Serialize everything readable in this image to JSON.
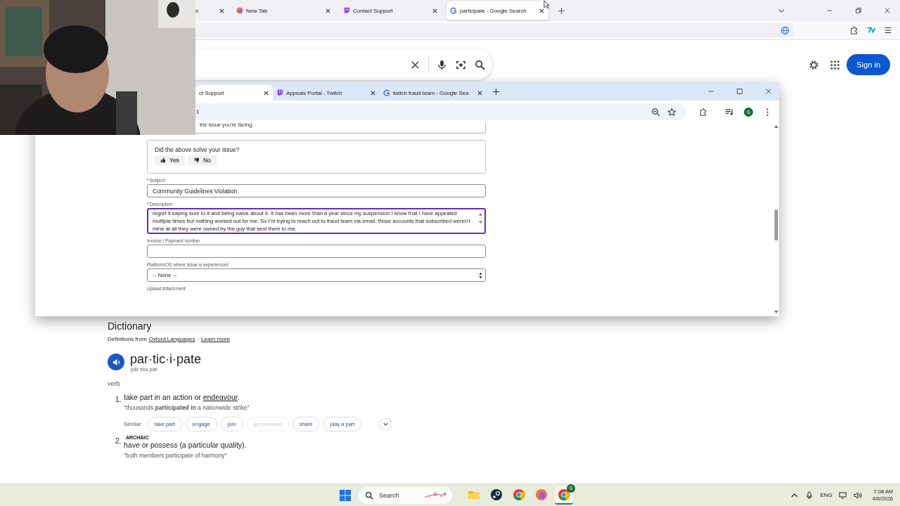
{
  "back_window": {
    "tabs": [
      {
        "kind": "none",
        "title": "n",
        "selected": false
      },
      {
        "kind": "firefox",
        "title": "New Tab",
        "selected": false
      },
      {
        "kind": "twitch",
        "title": "Contact Support",
        "selected": false
      },
      {
        "kind": "google",
        "title": "participate - Google Search",
        "selected": true
      }
    ],
    "page": {
      "sign_in": "Sign in",
      "dictionary": {
        "heading": "Dictionary",
        "source": {
          "prefix": "Definitions from",
          "link": "Oxford Languages",
          "separator": "·",
          "more": "Learn more"
        },
        "word": "par·tic·i·pate",
        "pronunciation": "/pärˈtisəˌpāt/",
        "part_of_speech": "verb",
        "senses": [
          {
            "number": "1.",
            "definition": "take part in an action or ",
            "link": "endeavour",
            "end": ".",
            "example": "\"thousands **participated in** a nationwide strike\"",
            "similar_label": "Similar:",
            "similar": [
              {
                "label": "take part",
                "disabled": false
              },
              {
                "label": "engage",
                "disabled": false
              },
              {
                "label": "join",
                "disabled": false
              },
              {
                "label": "get involved",
                "disabled": true
              },
              {
                "label": "share",
                "disabled": false
              },
              {
                "label": "play a part",
                "disabled": false
              }
            ]
          },
          {
            "number": "2.",
            "tag": "ARCHAIC",
            "definition": "have or possess (a particular quality).",
            "example": "\"both members participate of harmony\""
          }
        ]
      }
    }
  },
  "front_window": {
    "tabs": [
      {
        "kind": "none",
        "title": "ct Support",
        "selected": true
      },
      {
        "kind": "twitch",
        "title": "Appeals Portal - Twitch",
        "selected": false
      },
      {
        "kind": "google",
        "title": "twitch fraud team - Google Sea",
        "selected": false
      }
    ],
    "address": "t",
    "avatar": "S",
    "form": {
      "issue_tail": "the issue you're facing.",
      "feedback": {
        "question": "Did the above solve your issue?",
        "buttons": [
          {
            "kind": "up",
            "label": "Yes"
          },
          {
            "kind": "down",
            "label": "No"
          }
        ]
      },
      "fields": [
        {
          "kind": "input",
          "label": "Subject",
          "required_mark": "*",
          "value": "Community Guidelines Violation"
        },
        {
          "kind": "textarea",
          "label": "Description",
          "required_mark": "*",
          "focused": true,
          "value": "regret it saying sure to it and being naive about it. It has been more than a year since my suspension I know that I have appealed multiple times but nothing worked out for me. So I'm trying to reach out to fraud team via email. those accounts that subscribed weren't mine at all they were owned by the guy that sent them to me."
        },
        {
          "kind": "input",
          "label": "Invoice / Payment number"
        },
        {
          "kind": "select",
          "label": "Platform/OS where issue is experienced",
          "value": "-- None --"
        },
        {
          "kind": "upload",
          "label": "Upload Attachment"
        }
      ]
    }
  },
  "taskbar": {
    "search": "Search",
    "apps": [
      {
        "kind": "explorer",
        "active": false
      },
      {
        "kind": "steam",
        "active": false
      },
      {
        "kind": "chrome",
        "active": false
      },
      {
        "kind": "firefox",
        "active": false
      },
      {
        "kind": "chrome",
        "badge": "S",
        "active": true
      }
    ],
    "language": "ENG",
    "time": "7:08 AM",
    "date": "4/6/2026"
  }
}
